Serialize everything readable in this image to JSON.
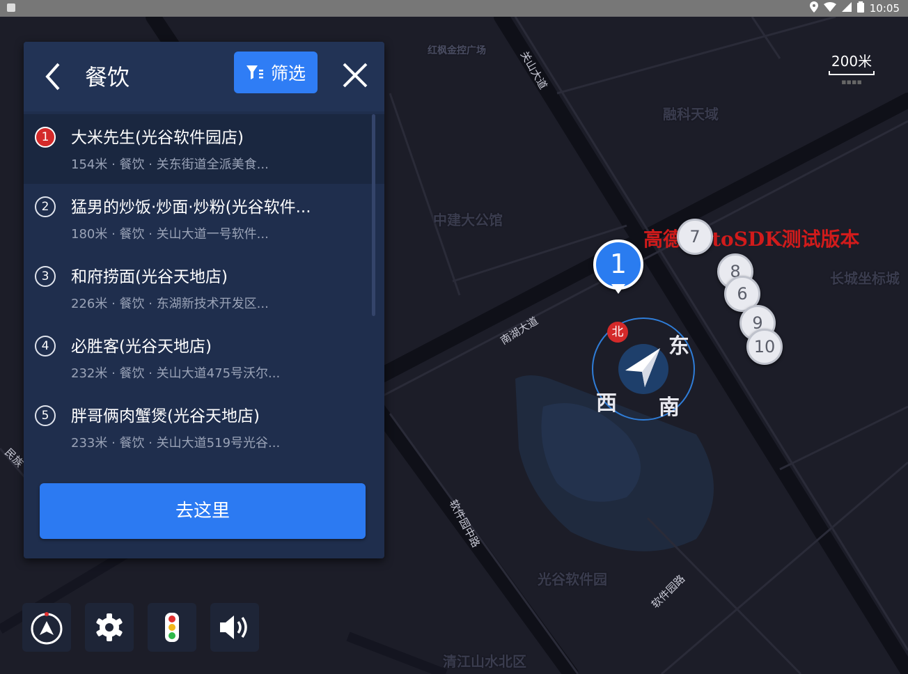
{
  "status_bar": {
    "time": "10:05"
  },
  "map": {
    "scale": {
      "value": "200米"
    },
    "pois": [
      "红枫金控广场",
      "融科天域",
      "中建大公馆",
      "长城坐标城",
      "光谷软件园",
      "清江山水北区"
    ],
    "roads": [
      "关山大道",
      "南湖大道",
      "软件园中路",
      "软件园路",
      "民族"
    ],
    "watermark": "高德AutoSDK测试版本",
    "main_marker": "1",
    "markers": [
      "7",
      "8",
      "6",
      "9",
      "10"
    ],
    "compass": {
      "north": "北",
      "east": "东",
      "south": "南",
      "west": "西"
    }
  },
  "panel": {
    "title": "餐饮",
    "filter_label": "筛选",
    "go_label": "去这里",
    "items": [
      {
        "num": "1",
        "name": "大米先生(光谷软件园店)",
        "desc": "154米 · 餐饮 · 关东街道全派美食..."
      },
      {
        "num": "2",
        "name": "猛男的炒饭·炒面·炒粉(光谷软件...",
        "desc": "180米 · 餐饮 · 关山大道一号软件..."
      },
      {
        "num": "3",
        "name": "和府捞面(光谷天地店)",
        "desc": "226米 · 餐饮 · 东湖新技术开发区..."
      },
      {
        "num": "4",
        "name": "必胜客(光谷天地店)",
        "desc": "232米 · 餐饮 · 关山大道475号沃尔..."
      },
      {
        "num": "5",
        "name": "胖哥俩肉蟹煲(光谷天地店)",
        "desc": "233米 · 餐饮 · 关山大道519号光谷..."
      }
    ]
  },
  "toolbar": {
    "buttons": [
      "compass-icon",
      "gear-icon",
      "traffic-light-icon",
      "speaker-icon"
    ]
  }
}
